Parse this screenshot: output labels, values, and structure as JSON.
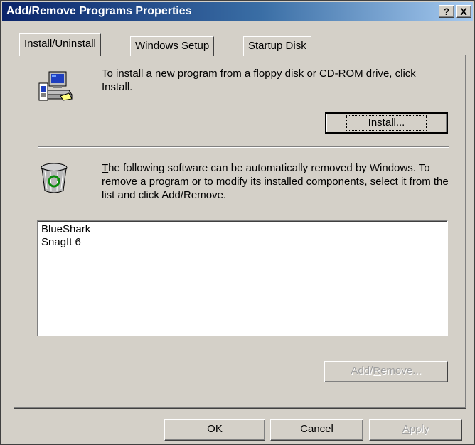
{
  "window": {
    "title": "Add/Remove Programs Properties",
    "help_label": "?",
    "close_label": "X"
  },
  "tabs": [
    {
      "label": "Install/Uninstall",
      "active": true
    },
    {
      "label": "Windows Setup",
      "active": false
    },
    {
      "label": "Startup Disk",
      "active": false
    }
  ],
  "install_section": {
    "text": "To install a new program from a floppy disk or CD-ROM drive, click Install.",
    "button": {
      "prefix": "",
      "accel": "I",
      "suffix": "nstall..."
    }
  },
  "uninstall_section": {
    "text_accel": "T",
    "text_rest": "he following software can be automatically removed by Windows. To remove a program or to modify its installed components, select it from the list and click Add/Remove.",
    "programs": [
      "BlueShark",
      "SnagIt 6"
    ],
    "button": {
      "prefix": "Add/",
      "accel": "R",
      "suffix": "emove...",
      "enabled": false
    }
  },
  "footer": {
    "ok": "OK",
    "cancel": "Cancel",
    "apply": {
      "accel": "A",
      "suffix": "pply",
      "enabled": false
    }
  },
  "colors": {
    "face": "#d4d0c8",
    "title_start": "#0a246a",
    "title_end": "#a6caf0",
    "disabled_text": "#a0a0a0"
  },
  "icons": [
    "setup-computer-icon",
    "recycle-bin-icon"
  ]
}
